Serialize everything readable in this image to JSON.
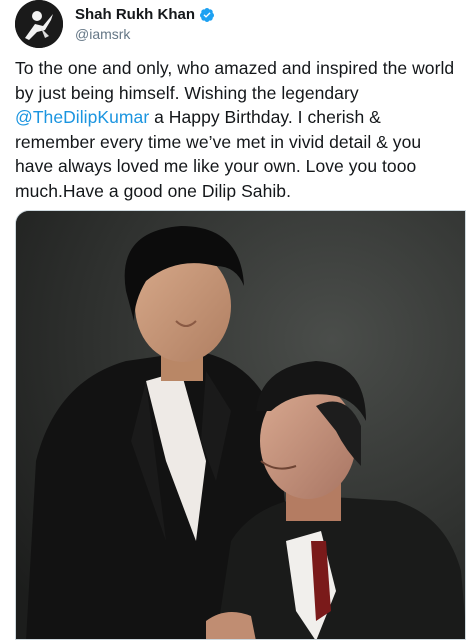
{
  "user": {
    "display_name": "Shah Rukh Khan",
    "handle": "@iamsrk",
    "verified_icon": "verified-badge-icon"
  },
  "tweet": {
    "text_part1": "To the one and only, who amazed and inspired the world by just being himself. Wishing the legendary ",
    "mention": "@TheDilipKumar",
    "text_part2": " a Happy Birthday. I cherish & remember every time we’ve met in vivid detail & you have always loved me like your own. Love you tooo much.Have a good one Dilip Sahib."
  },
  "colors": {
    "mention": "#1b95e0",
    "verified": "#1da1f2",
    "text": "#14171a",
    "handle": "#657786"
  }
}
